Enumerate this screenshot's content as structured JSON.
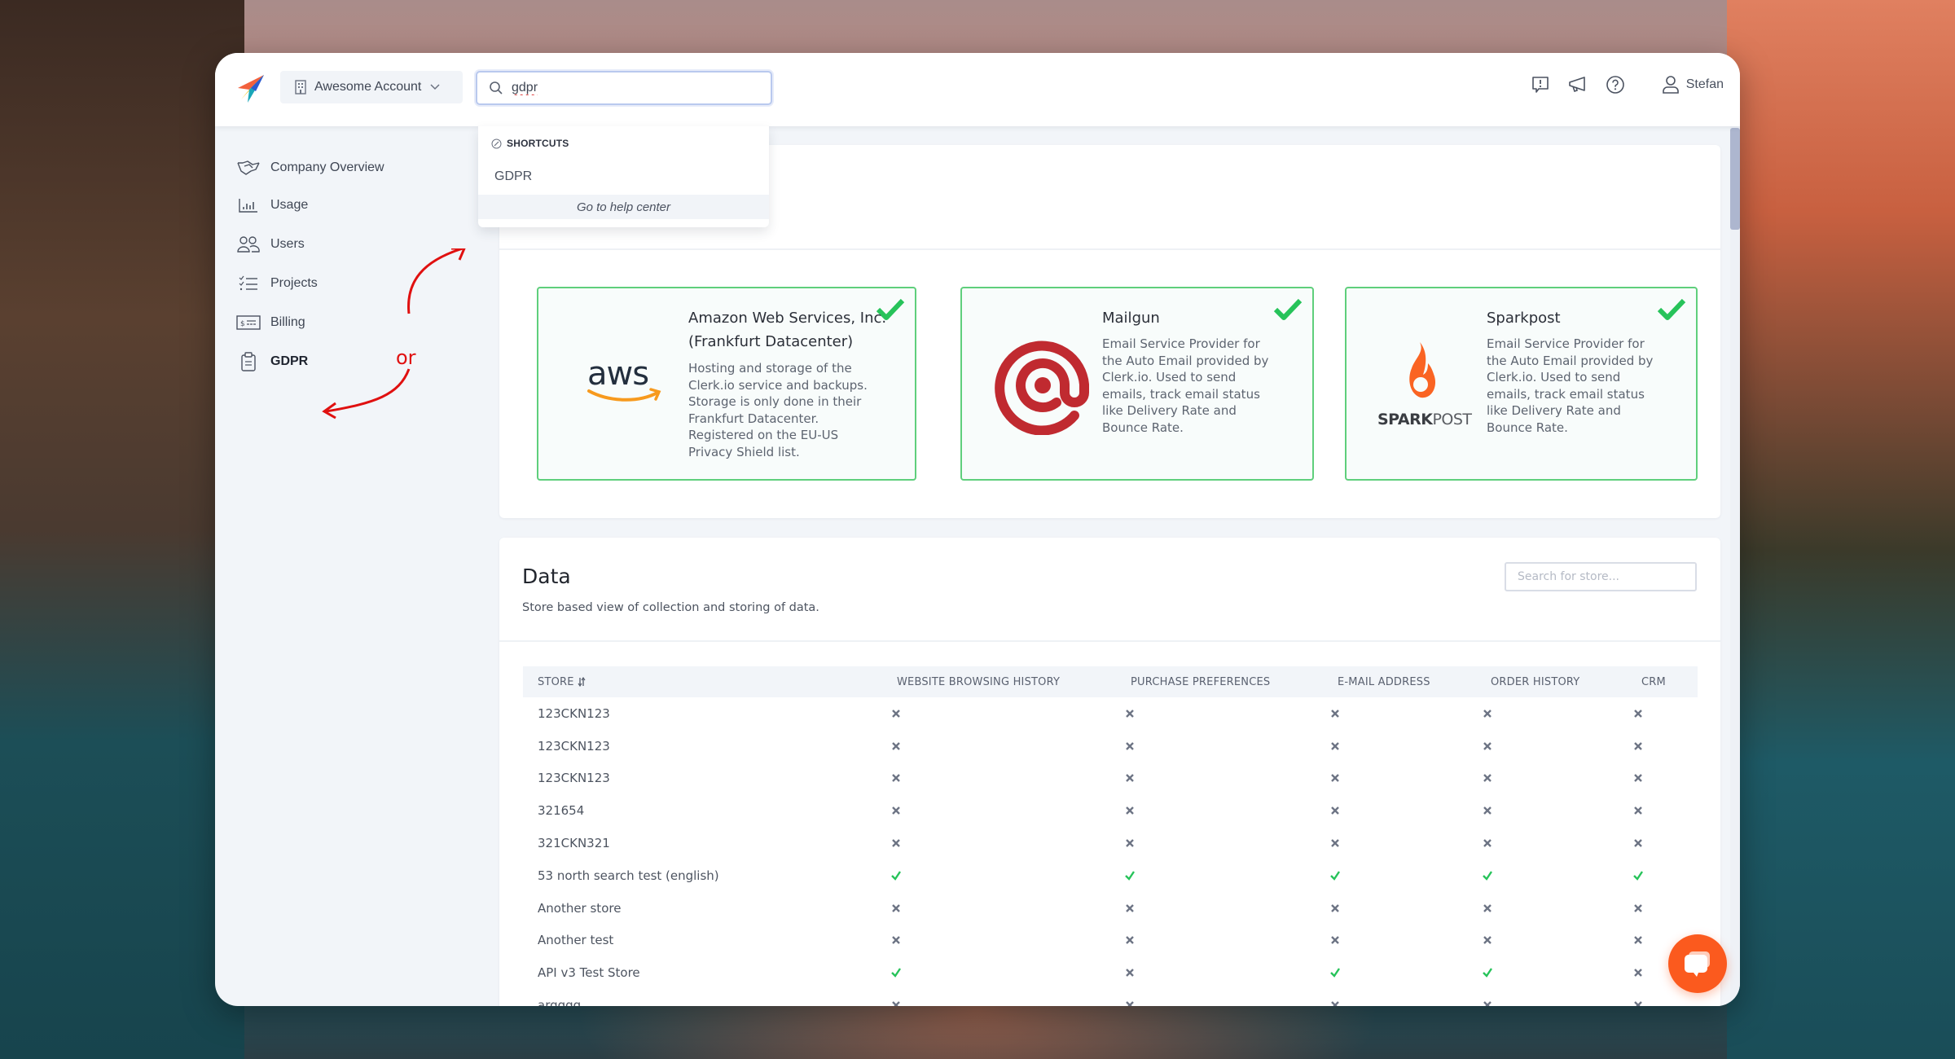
{
  "header": {
    "account_name": "Awesome Account",
    "search_value": "gdpr",
    "user_name": "Stefan",
    "icons": [
      "feedback-icon",
      "announcements-icon",
      "help-icon",
      "user-icon"
    ]
  },
  "search_dropdown": {
    "section_label": "SHORTCUTS",
    "items": [
      {
        "label": "GDPR"
      }
    ],
    "footer_label": "Go to help center"
  },
  "sidebar": {
    "items": [
      {
        "label": "Company Overview",
        "icon": "handshake-icon",
        "active": false
      },
      {
        "label": "Usage",
        "icon": "bar-chart-icon",
        "active": false
      },
      {
        "label": "Users",
        "icon": "users-icon",
        "active": false
      },
      {
        "label": "Projects",
        "icon": "checklist-icon",
        "active": false
      },
      {
        "label": "Billing",
        "icon": "billing-icon",
        "active": false
      },
      {
        "label": "GDPR",
        "icon": "clipboard-icon",
        "active": true
      }
    ]
  },
  "annotation": {
    "text": "or",
    "color": "#e01010"
  },
  "services": [
    {
      "name": "Amazon Web Services, Inc.",
      "name_line2": "(Frankfurt Datacenter)",
      "logo": "aws-logo",
      "description_lines": [
        "Hosting and storage of the",
        "Clerk.io service and backups.",
        "Storage is only done in their",
        "Frankfurt Datacenter.",
        "Registered on the EU-US",
        "Privacy Shield list."
      ],
      "approved": true
    },
    {
      "name": "Mailgun",
      "logo": "mailgun-logo",
      "description_lines": [
        "Email Service Provider for",
        "the Auto Email provided by",
        "Clerk.io. Used to send",
        "emails, track email status",
        "like Delivery Rate and",
        "Bounce Rate."
      ],
      "approved": true
    },
    {
      "name": "Sparkpost",
      "logo": "sparkpost-logo",
      "logo_text_bold": "SPARK",
      "logo_text_light": "POST",
      "description_lines": [
        "Email Service Provider for",
        "the Auto Email provided by",
        "Clerk.io. Used to send",
        "emails, track email status",
        "like Delivery Rate and",
        "Bounce Rate."
      ],
      "approved": true
    }
  ],
  "data_section": {
    "title": "Data",
    "subtitle": "Store based view of collection and storing of data.",
    "search_placeholder": "Search for store...",
    "columns": [
      "STORE",
      "WEBSITE BROWSING HISTORY",
      "PURCHASE PREFERENCES",
      "E-MAIL ADDRESS",
      "ORDER HISTORY",
      "CRM"
    ],
    "rows": [
      {
        "store": "123CKN123",
        "values": [
          false,
          false,
          false,
          false,
          false
        ]
      },
      {
        "store": "123CKN123",
        "values": [
          false,
          false,
          false,
          false,
          false
        ]
      },
      {
        "store": "123CKN123",
        "values": [
          false,
          false,
          false,
          false,
          false
        ]
      },
      {
        "store": "321654",
        "values": [
          false,
          false,
          false,
          false,
          false
        ]
      },
      {
        "store": "321CKN321",
        "values": [
          false,
          false,
          false,
          false,
          false
        ]
      },
      {
        "store": "53 north search test (english)",
        "values": [
          true,
          true,
          true,
          true,
          true
        ]
      },
      {
        "store": "Another store",
        "values": [
          false,
          false,
          false,
          false,
          false
        ]
      },
      {
        "store": "Another test",
        "values": [
          false,
          false,
          false,
          false,
          false
        ]
      },
      {
        "store": "API v3 Test Store",
        "values": [
          true,
          false,
          true,
          true,
          false
        ]
      },
      {
        "store": "argggg",
        "values": [
          false,
          false,
          false,
          false,
          false
        ]
      }
    ]
  },
  "colors": {
    "accent_green": "#27c35a",
    "cross_gray": "#6d7484",
    "chat_orange": "#fb5a1e",
    "mailgun_red": "#c02a30",
    "sparkpost_orange": "#fa6423",
    "aws_orange": "#f79a1e"
  }
}
